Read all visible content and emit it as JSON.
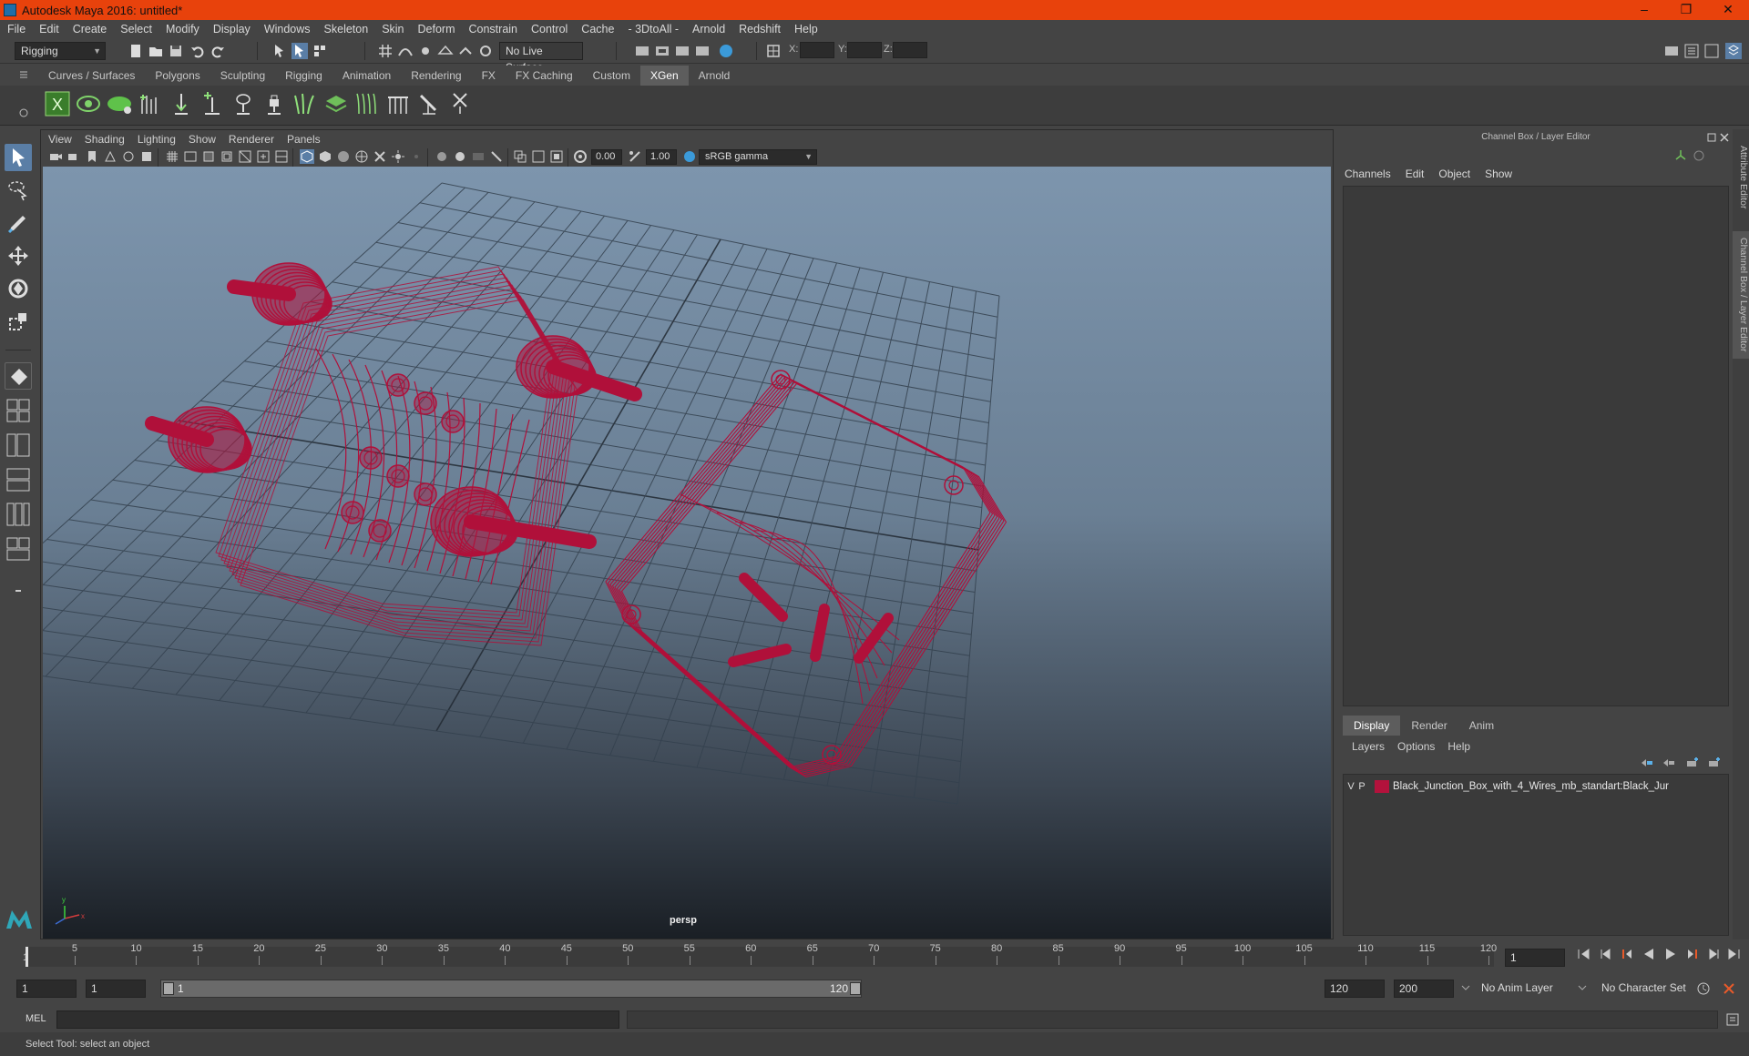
{
  "window": {
    "title": "Autodesk Maya 2016: untitled*",
    "controls": [
      "–",
      "❐",
      "✕"
    ]
  },
  "menubar": [
    "File",
    "Edit",
    "Create",
    "Select",
    "Modify",
    "Display",
    "Windows",
    "Skeleton",
    "Skin",
    "Deform",
    "Constrain",
    "Control",
    "Cache",
    "- 3DtoAll -",
    "Arnold",
    "Redshift",
    "Help"
  ],
  "statusline": {
    "menuset": "Rigging",
    "live_surface": "No Live Surface",
    "coord_labels": [
      "X:",
      "Y:",
      "Z:"
    ]
  },
  "shelf": {
    "tabs": [
      "Curves / Surfaces",
      "Polygons",
      "Sculpting",
      "Rigging",
      "Animation",
      "Rendering",
      "FX",
      "FX Caching",
      "Custom",
      "XGen",
      "Arnold"
    ],
    "active_tab": "XGen",
    "icons": [
      "xgen-logo-icon",
      "xgen-preview-icon",
      "xgen-eye-icon",
      "add-guides-icon",
      "place-guide-icon",
      "add-guide-icon",
      "sculpt-guide-icon",
      "lock-length-icon",
      "grass-icon",
      "layer-icon",
      "curves-icon",
      "comb-icon",
      "brush-icon",
      "cut-icon"
    ]
  },
  "viewport": {
    "menu": [
      "View",
      "Shading",
      "Lighting",
      "Show",
      "Renderer",
      "Panels"
    ],
    "exposure": "0.00",
    "gamma": "1.00",
    "color_space": "sRGB gamma",
    "camera_label": "persp",
    "wire_color": "#b0103a"
  },
  "channel_box": {
    "title": "Channel Box / Layer Editor",
    "menu": [
      "Channels",
      "Edit",
      "Object",
      "Show"
    ],
    "layer_tabs": [
      "Display",
      "Render",
      "Anim"
    ],
    "active_layer_tab": "Display",
    "layer_menu": [
      "Layers",
      "Options",
      "Help"
    ],
    "layers": [
      {
        "v": "V",
        "p": "P",
        "name": "Black_Junction_Box_with_4_Wires_mb_standart:Black_Jur",
        "color": "#b3123c"
      }
    ]
  },
  "side_tabs": [
    "Attribute Editor",
    "Channel Box / Layer Editor"
  ],
  "timeline": {
    "ticks": [
      "1",
      "5",
      "10",
      "15",
      "20",
      "25",
      "30",
      "35",
      "40",
      "45",
      "50",
      "55",
      "60",
      "65",
      "70",
      "75",
      "80",
      "85",
      "90",
      "95",
      "100",
      "105",
      "110",
      "115",
      "120"
    ],
    "current_frame": "1"
  },
  "range": {
    "start_field": "1",
    "playback_start": "1",
    "slider_start": "1",
    "slider_end": "120",
    "playback_end": "120",
    "end_field": "200",
    "anim_layer": "No Anim Layer",
    "character_set": "No Character Set"
  },
  "cmdline": {
    "label": "MEL"
  },
  "status": {
    "help_text": "Select Tool: select an object"
  }
}
